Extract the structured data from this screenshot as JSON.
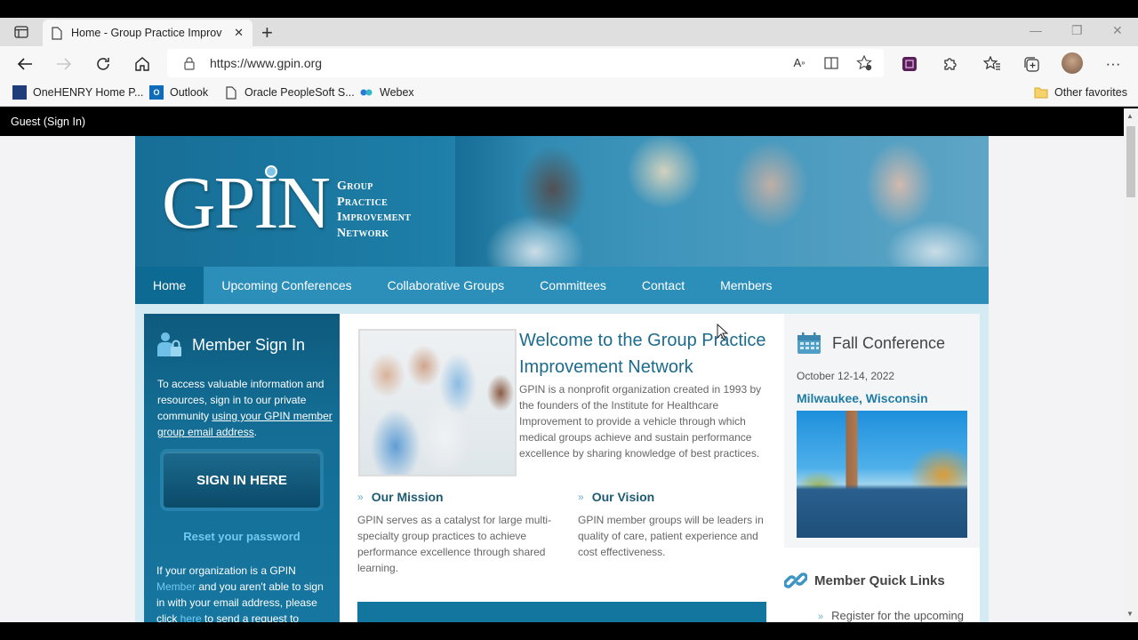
{
  "browser": {
    "tab_title": "Home - Group Practice Improvement Network",
    "tab_title_display": "Home - Group Practice Improve",
    "url": "https://www.gpin.org",
    "bookmarks": [
      {
        "label": "OneHENRY Home P...",
        "icon": "onehenry-icon"
      },
      {
        "label": "Outlook",
        "icon": "outlook-icon"
      },
      {
        "label": "Oracle PeopleSoft S...",
        "icon": "page-icon"
      },
      {
        "label": "Webex",
        "icon": "webex-icon"
      }
    ],
    "other_favorites": "Other favorites"
  },
  "site": {
    "guest_label": "Guest (Sign In)",
    "logo": {
      "main": "GPIN",
      "line1": "Group",
      "line2": "Practice",
      "line3": "Improvement",
      "line4": "Network"
    },
    "menu": [
      {
        "label": "Home",
        "active": true
      },
      {
        "label": "Upcoming Conferences",
        "active": false
      },
      {
        "label": "Collaborative Groups",
        "active": false
      },
      {
        "label": "Committees",
        "active": false
      },
      {
        "label": "Contact",
        "active": false
      },
      {
        "label": "Members",
        "active": false
      }
    ],
    "signin": {
      "title": "Member Sign In",
      "intro_text": "To access valuable information and resources, sign in to our private community ",
      "intro_link": "using your GPIN member group email address",
      "intro_end": ".",
      "button": "SIGN IN HERE",
      "reset": "Reset your password",
      "note_1": " If your organization is a GPIN ",
      "note_member_link": "Member",
      "note_2": " and you aren't able to sign in with your email address, please click ",
      "note_here_link": "here",
      "note_3": " to send a request to"
    },
    "welcome": {
      "title": "Welcome to the Group Practice Improvement Network",
      "text": "GPIN is a nonprofit organization created in 1993 by the founders of the Institute for Healthcare Improvement to provide a vehicle through which medical groups achieve and sustain performance excellence by sharing knowledge of best practices."
    },
    "mission": {
      "title": "Our Mission",
      "text": "GPIN serves as a catalyst for large multi-specialty group practices to achieve performance excellence through shared learning."
    },
    "vision": {
      "title": "Our Vision",
      "text": "GPIN member groups will be leaders in quality of care, patient experience and cost effectiveness."
    },
    "conference": {
      "title": "Fall Conference",
      "date": "October 12-14, 2022",
      "location": "Milwaukee, Wisconsin"
    },
    "quick_links": {
      "title": "Member Quick Links",
      "items": [
        "Register for the upcoming"
      ]
    }
  }
}
